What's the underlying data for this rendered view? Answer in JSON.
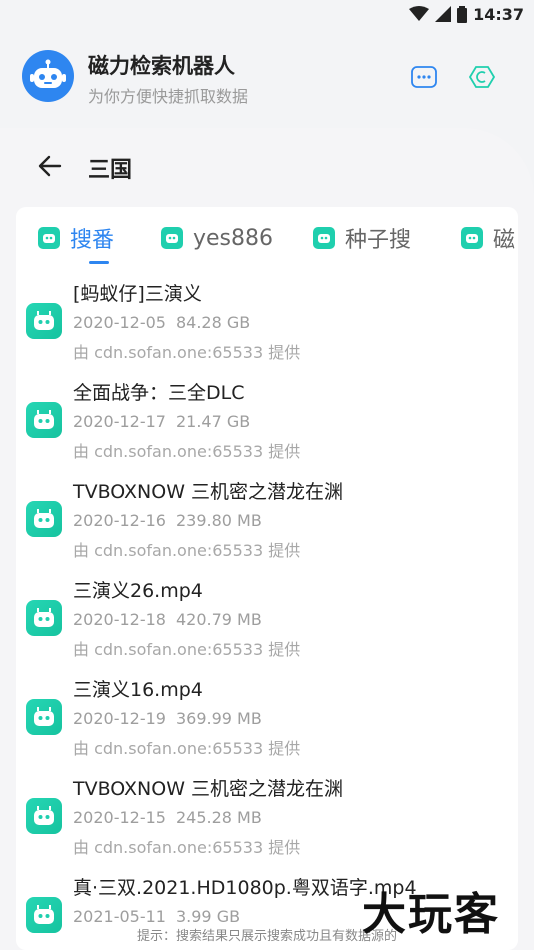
{
  "status_bar": {
    "time": "14:37"
  },
  "app": {
    "title": "磁力检索机器人",
    "subtitle": "为你方便快捷抓取数据"
  },
  "page": {
    "title": "三国"
  },
  "tabs": [
    {
      "label": "搜番",
      "active": true
    },
    {
      "label": "yes886",
      "active": false
    },
    {
      "label": "种子搜",
      "active": false
    },
    {
      "label": "磁",
      "active": false
    }
  ],
  "results": [
    {
      "title": "[蚂蚁仔]三演义",
      "date": "2020-12-05",
      "size": "84.28 GB",
      "source": "由 cdn.sofan.one:65533 提供"
    },
    {
      "title": "全面战争：三全DLC",
      "date": "2020-12-17",
      "size": "21.47 GB",
      "source": "由 cdn.sofan.one:65533 提供"
    },
    {
      "title": "TVBOXNOW 三机密之潜龙在渊",
      "date": "2020-12-16",
      "size": "239.80 MB",
      "source": "由 cdn.sofan.one:65533 提供"
    },
    {
      "title": "三演义26.mp4",
      "date": "2020-12-18",
      "size": "420.79 MB",
      "source": "由 cdn.sofan.one:65533 提供"
    },
    {
      "title": "三演义16.mp4",
      "date": "2020-12-19",
      "size": "369.99 MB",
      "source": "由 cdn.sofan.one:65533 提供"
    },
    {
      "title": "TVBOXNOW 三机密之潜龙在渊",
      "date": "2020-12-15",
      "size": "245.28 MB",
      "source": "由 cdn.sofan.one:65533 提供"
    },
    {
      "title": "真·三双.2021.HD1080p.粤双语字.mp4",
      "date": "2021-05-11",
      "size": "3.99 GB",
      "source": ""
    }
  ],
  "footer": {
    "tip": "提示：搜索结果只展示搜索成功且有数据源的"
  },
  "watermark": "大玩客",
  "colors": {
    "accent": "#2e86f0",
    "bot_green": "#1fcfae"
  }
}
